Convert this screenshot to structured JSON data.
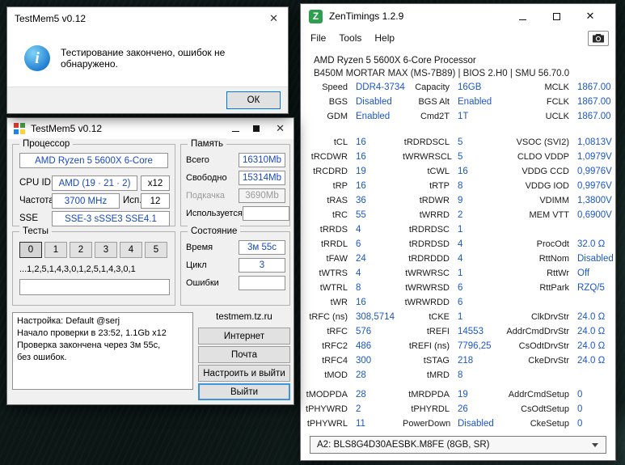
{
  "glyphs": {
    "close": "✕",
    "info": "i"
  },
  "colors": {
    "desktop_teal": "#0d1817",
    "zentimings_value_blue": "#1b57c9",
    "testmem_value_blue": "#1749c0",
    "focus_blue": "#0078d7",
    "logo_green": "#2e9e4f"
  },
  "dialog": {
    "title": "TestMem5 v0.12",
    "message": "Тестирование закончено, ошибок не обнаружено.",
    "ok_label": "ОК"
  },
  "testmem": {
    "title": "TestMem5 v0.12",
    "processor": {
      "title": "Процессор",
      "name": "AMD Ryzen 5 5600X 6-Core",
      "cpu_id_label": "CPU ID",
      "cpu_id_value": "AMD (19 · 21 · 2)",
      "cpu_id_mult": "x12",
      "freq_label": "Частота",
      "freq_value": "3700 MHz",
      "usage_label": "Исп.",
      "usage_value": "12",
      "sse_label": "SSE",
      "sse_value": "SSE-3 sSSE3 SSE4.1"
    },
    "memory": {
      "title": "Память",
      "rows": [
        {
          "label": "Всего",
          "value": "16310Mb",
          "muted": false
        },
        {
          "label": "Свободно",
          "value": "15314Mb",
          "muted": false
        },
        {
          "label": "Подкачка",
          "value": "3690Mb",
          "muted": true
        },
        {
          "label": "Используется",
          "value": "",
          "muted": false
        }
      ]
    },
    "tests": {
      "title": "Тесты",
      "buttons": [
        "0",
        "1",
        "2",
        "3",
        "4",
        "5"
      ],
      "active_button": "0",
      "sequence": "...1,2,5,1,4,3,0,1,2,5,1,4,3,0,1"
    },
    "state": {
      "title": "Состояние",
      "rows": [
        {
          "label": "Время",
          "value": "3м 55с"
        },
        {
          "label": "Цикл",
          "value": "3"
        },
        {
          "label": "Ошибки",
          "value": ""
        }
      ]
    },
    "log_lines": [
      "Настройка: Default @serj",
      "Начало проверки в 23:52, 1.1Gb x12",
      "Проверка закончена через 3м 55с,",
      "без ошибок."
    ],
    "site_label": "testmem.tz.ru",
    "action_buttons": [
      {
        "label": "Интернет",
        "focused": false
      },
      {
        "label": "Почта",
        "focused": false
      },
      {
        "label": "Настроить и выйти",
        "focused": false
      },
      {
        "label": "Выйти",
        "focused": true
      }
    ]
  },
  "zentimings": {
    "title": "ZenTimings 1.2.9",
    "logo_letter": "Z",
    "menu": [
      "File",
      "Tools",
      "Help"
    ],
    "cpu_line": "AMD Ryzen 5 5600X 6-Core Processor",
    "board_line": "B450M MORTAR MAX (MS-7B89) | BIOS 2.H0 | SMU 56.70.0",
    "rows": [
      {
        "c": [
          "Speed",
          "DDR4-3734",
          "Capacity",
          "16GB",
          "MCLK",
          "1867.00"
        ]
      },
      {
        "c": [
          "BGS",
          "Disabled",
          "BGS Alt",
          "Enabled",
          "FCLK",
          "1867.00"
        ]
      },
      {
        "c": [
          "GDM",
          "Enabled",
          "Cmd2T",
          "1T",
          "UCLK",
          "1867.00"
        ],
        "gap": 14
      },
      {
        "c": [
          "tCL",
          "16",
          "tRDRDSCL",
          "5",
          "VSOC (SVI2)",
          "1,0813V"
        ]
      },
      {
        "c": [
          "tRCDWR",
          "16",
          "tWRWRSCL",
          "5",
          "CLDO VDDP",
          "1,0979V"
        ]
      },
      {
        "c": [
          "tRCDRD",
          "19",
          "tCWL",
          "16",
          "VDDG CCD",
          "0,9976V"
        ]
      },
      {
        "c": [
          "tRP",
          "16",
          "tRTP",
          "8",
          "VDDG IOD",
          "0,9976V"
        ]
      },
      {
        "c": [
          "tRAS",
          "36",
          "tRDWR",
          "9",
          "VDIMM",
          "1,3800V"
        ]
      },
      {
        "c": [
          "tRC",
          "55",
          "tWRRD",
          "2",
          "MEM VTT",
          "0,6900V"
        ]
      },
      {
        "c": [
          "tRRDS",
          "4",
          "tRDRDSC",
          "1",
          "",
          ""
        ]
      },
      {
        "c": [
          "tRRDL",
          "6",
          "tRDRDSD",
          "4",
          "ProcOdt",
          "32.0 Ω"
        ]
      },
      {
        "c": [
          "tFAW",
          "24",
          "tRDRDDD",
          "4",
          "RttNom",
          "Disabled"
        ]
      },
      {
        "c": [
          "tWTRS",
          "4",
          "tWRWRSC",
          "1",
          "RttWr",
          "Off"
        ]
      },
      {
        "c": [
          "tWTRL",
          "8",
          "tWRWRSD",
          "6",
          "RttPark",
          "RZQ/5"
        ]
      },
      {
        "c": [
          "tWR",
          "16",
          "tWRWRDD",
          "6",
          "",
          ""
        ]
      },
      {
        "c": [
          "tRFC (ns)",
          "308,5714",
          "tCKE",
          "1",
          "ClkDrvStr",
          "24.0 Ω"
        ]
      },
      {
        "c": [
          "tRFC",
          "576",
          "tREFI",
          "14553",
          "AddrCmdDrvStr",
          "24.0 Ω"
        ]
      },
      {
        "c": [
          "tRFC2",
          "486",
          "tREFI (ns)",
          "7796,25",
          "CsOdtDrvStr",
          "24.0 Ω"
        ]
      },
      {
        "c": [
          "tRFC4",
          "300",
          "tSTAG",
          "218",
          "CkeDrvStr",
          "24.0 Ω"
        ]
      },
      {
        "c": [
          "tMOD",
          "28",
          "tMRD",
          "8",
          "",
          ""
        ],
        "gap": 6
      },
      {
        "c": [
          "tMODPDA",
          "28",
          "tMRDPDA",
          "19",
          "AddrCmdSetup",
          "0"
        ]
      },
      {
        "c": [
          "tPHYWRD",
          "2",
          "tPHYRDL",
          "26",
          "CsOdtSetup",
          "0"
        ]
      },
      {
        "c": [
          "tPHYWRL",
          "11",
          "PowerDown",
          "Disabled",
          "CkeSetup",
          "0"
        ]
      }
    ],
    "dimm_selector": "A2: BLS8G4D30AESBK.M8FE (8GB, SR)"
  }
}
